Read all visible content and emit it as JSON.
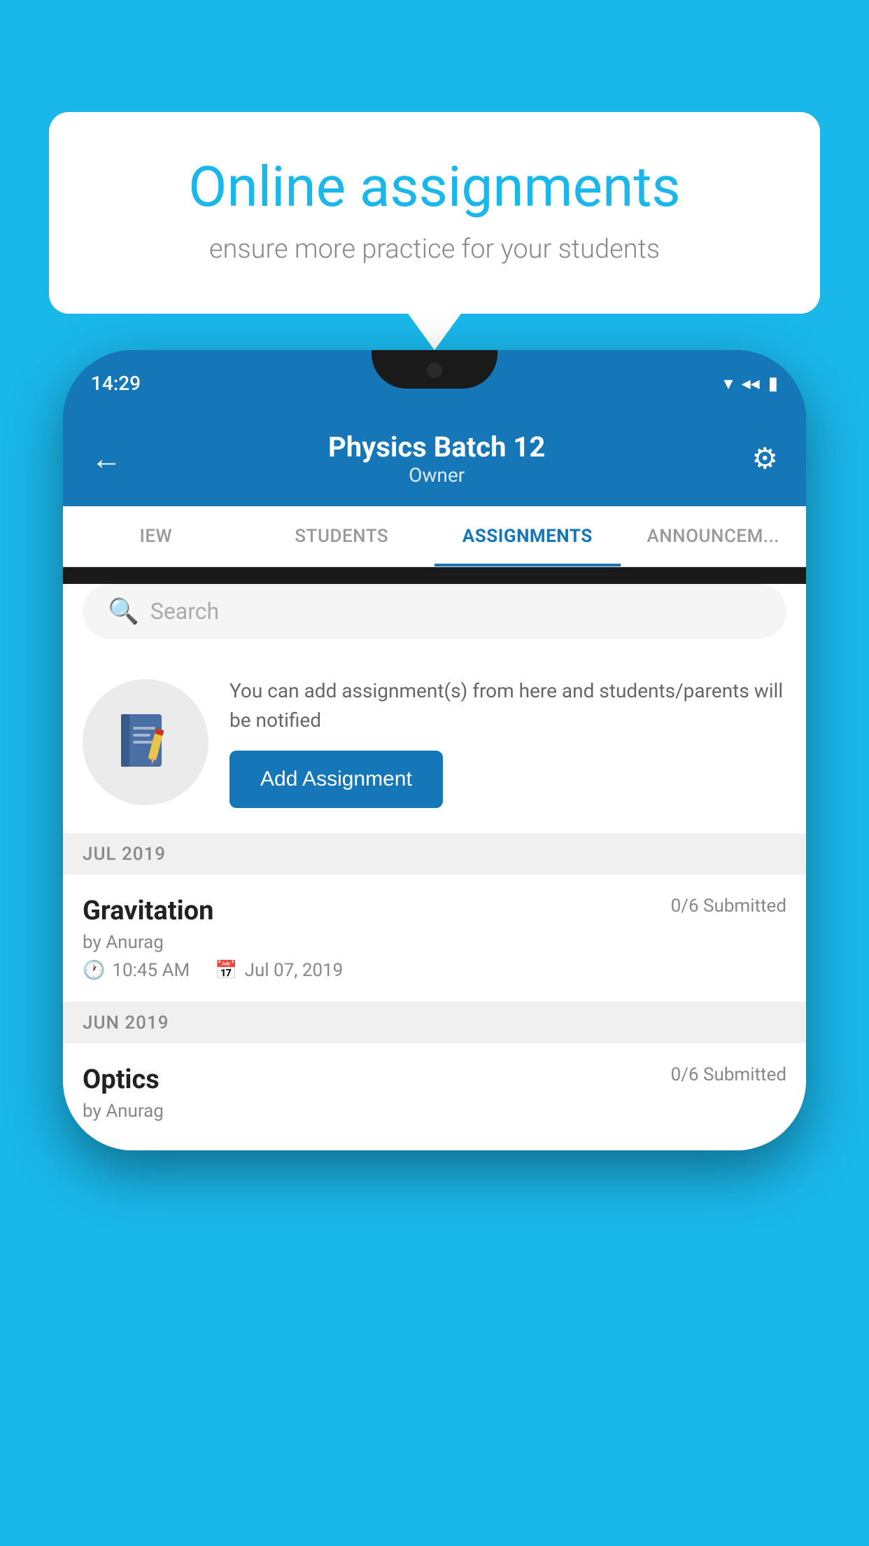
{
  "background": {
    "color": "#1ab7ea"
  },
  "speech_bubble": {
    "title": "Online assignments",
    "subtitle": "ensure more practice for your students"
  },
  "status_bar": {
    "time": "14:29",
    "icons": [
      "wifi",
      "signal",
      "battery"
    ]
  },
  "header": {
    "title": "Physics Batch 12",
    "subtitle": "Owner",
    "back_label": "←",
    "settings_label": "⚙"
  },
  "tabs": [
    {
      "label": "IEW",
      "active": false
    },
    {
      "label": "STUDENTS",
      "active": false
    },
    {
      "label": "ASSIGNMENTS",
      "active": true
    },
    {
      "label": "ANNOUNCEM...",
      "active": false
    }
  ],
  "search": {
    "placeholder": "Search"
  },
  "add_assignment_section": {
    "description": "You can add assignment(s) from here and students/parents will be notified",
    "button_label": "Add Assignment"
  },
  "sections": [
    {
      "month": "JUL 2019",
      "assignments": [
        {
          "name": "Gravitation",
          "submitted": "0/6 Submitted",
          "author": "by Anurag",
          "time": "10:45 AM",
          "date": "Jul 07, 2019"
        }
      ]
    },
    {
      "month": "JUN 2019",
      "assignments": [
        {
          "name": "Optics",
          "submitted": "0/6 Submitted",
          "author": "by Anurag",
          "time": "",
          "date": ""
        }
      ]
    }
  ]
}
